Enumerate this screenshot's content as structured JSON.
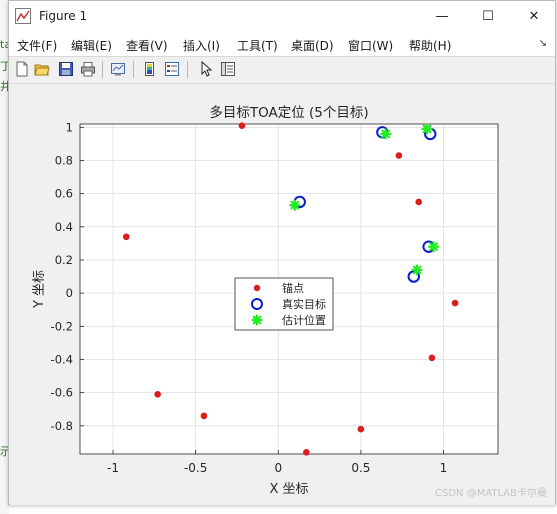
{
  "window": {
    "title": "Figure 1",
    "minimize_glyph": "—",
    "maximize_glyph": "☐",
    "close_glyph": "✕"
  },
  "menu": {
    "items": [
      "文件(F)",
      "编辑(E)",
      "查看(V)",
      "插入(I)",
      "工具(T)",
      "桌面(D)",
      "窗口(W)",
      "帮助(H)"
    ],
    "overflow_glyph": "↘"
  },
  "toolbar": {
    "icons": [
      "new-figure-icon",
      "open-file-icon",
      "save-icon",
      "print-icon",
      "link-plot-icon",
      "insert-colorbar-icon",
      "insert-legend-icon",
      "edit-plot-icon",
      "property-inspector-icon"
    ]
  },
  "watermark": "CSDN @MATLAB卡尔曼",
  "left_fragments": [
    "ta",
    "丁",
    "井",
    "示"
  ],
  "chart_data": {
    "type": "scatter",
    "title": "多目标TOA定位 (5个目标)",
    "xlabel": "X 坐标",
    "ylabel": "Y 坐标",
    "xlim": [
      -1.2,
      1.33
    ],
    "ylim": [
      -0.97,
      1.02
    ],
    "xticks": [
      -1,
      -0.5,
      0,
      0.5,
      1
    ],
    "xtick_labels": [
      "-1",
      "-0.5",
      "0",
      "0.5",
      "1"
    ],
    "yticks": [
      -0.8,
      -0.6,
      -0.4,
      -0.2,
      0,
      0.2,
      0.4,
      0.6,
      0.8,
      1
    ],
    "ytick_labels": [
      "-0.8",
      "-0.6",
      "-0.4",
      "-0.2",
      "0",
      "0.2",
      "0.4",
      "0.6",
      "0.8",
      "1"
    ],
    "grid": true,
    "legend_position": "center",
    "series": [
      {
        "name": "锚点",
        "marker": "filled-dot",
        "color": "#dd1c1c",
        "points": [
          [
            -0.22,
            1.01
          ],
          [
            0.73,
            0.83
          ],
          [
            0.85,
            0.55
          ],
          [
            -0.92,
            0.34
          ],
          [
            1.07,
            -0.06
          ],
          [
            0.93,
            -0.39
          ],
          [
            -0.73,
            -0.61
          ],
          [
            -0.45,
            -0.74
          ],
          [
            0.5,
            -0.82
          ],
          [
            0.17,
            -0.96
          ]
        ]
      },
      {
        "name": "真实目标",
        "marker": "circle",
        "color": "#0a1fcc",
        "points": [
          [
            0.63,
            0.97
          ],
          [
            0.92,
            0.96
          ],
          [
            0.13,
            0.55
          ],
          [
            0.91,
            0.28
          ],
          [
            0.82,
            0.1
          ]
        ]
      },
      {
        "name": "估计位置",
        "marker": "asterisk",
        "color": "#22ee22",
        "points": [
          [
            0.65,
            0.96
          ],
          [
            0.9,
            0.99
          ],
          [
            0.1,
            0.53
          ],
          [
            0.94,
            0.28
          ],
          [
            0.84,
            0.14
          ]
        ]
      }
    ]
  }
}
